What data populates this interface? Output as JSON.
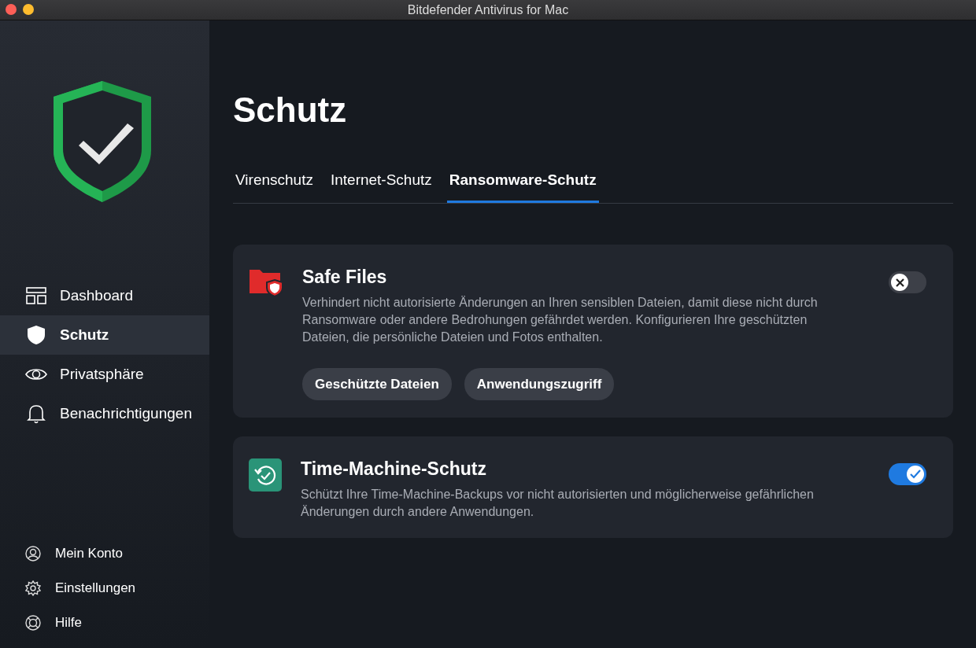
{
  "window": {
    "title": "Bitdefender Antivirus for Mac"
  },
  "sidebar": {
    "items": [
      {
        "label": "Dashboard",
        "selected": false
      },
      {
        "label": "Schutz",
        "selected": true
      },
      {
        "label": "Privatsphäre",
        "selected": false
      },
      {
        "label": "Benachrichtigungen",
        "selected": false
      }
    ],
    "footer_items": [
      {
        "label": "Mein Konto"
      },
      {
        "label": "Einstellungen"
      },
      {
        "label": "Hilfe"
      }
    ]
  },
  "page_title": "Schutz",
  "tabs": [
    {
      "label": "Virenschutz",
      "selected": false
    },
    {
      "label": "Internet-Schutz",
      "selected": false
    },
    {
      "label": "Ransomware-Schutz",
      "selected": true
    }
  ],
  "cards": [
    {
      "title": "Safe Files",
      "description": "Verhindert nicht autorisierte Änderungen an Ihren sensiblen Dateien, damit diese nicht durch Ransomware oder andere Bedrohungen gefährdet werden. Konfigurieren Ihre geschützten Dateien, die persönliche Dateien und Fotos enthalten.",
      "on": false,
      "buttons": [
        "Geschützte Dateien",
        "Anwendungszugriff"
      ]
    },
    {
      "title": "Time-Machine-Schutz",
      "description": "Schützt Ihre Time-Machine-Backups vor nicht autorisierten und möglicherweise gefährlichen Änderungen durch andere Anwendungen.",
      "on": true
    }
  ]
}
